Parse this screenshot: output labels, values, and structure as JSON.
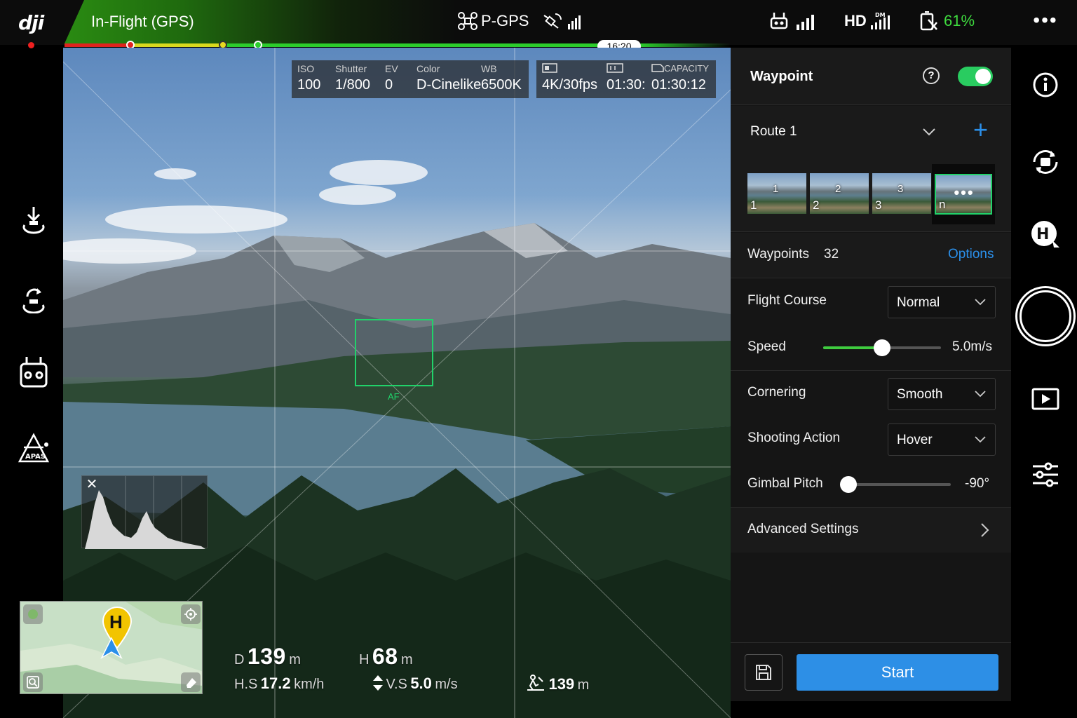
{
  "topbar": {
    "logo": "dji",
    "status": "In-Flight (GPS)",
    "gps_mode": "P-GPS",
    "hd_label": "HD",
    "hd_band": "DM",
    "battery_percent": "61%",
    "more": "•••",
    "remaining_time": "16:20"
  },
  "exposure": {
    "iso_label": "ISO",
    "iso_value": "100",
    "shutter_label": "Shutter",
    "shutter_value": "1/800",
    "ev_label": "EV",
    "ev_value": "0",
    "color_label": "Color",
    "color_value": "D-Cinelike",
    "wb_label": "WB",
    "wb_value": "6500K"
  },
  "storage": {
    "format_value": "4K/30fps",
    "rec_time_value": "01:30:",
    "capacity_label": "CAPACITY",
    "capacity_value": "01:30:12"
  },
  "camera": {
    "af_label": "AF",
    "histogram_close": "✕"
  },
  "left_controls": [
    {
      "name": "auto-takeoff-icon"
    },
    {
      "name": "return-to-home-icon"
    },
    {
      "name": "remote-controller-icon"
    },
    {
      "name": "apas-icon",
      "label": "APAS"
    }
  ],
  "map": {
    "home_marker": "H"
  },
  "telemetry": {
    "distance_label": "D",
    "distance_value": "139",
    "distance_unit": "m",
    "height_label": "H",
    "height_value": "68",
    "height_unit": "m",
    "hs_label": "H.S",
    "hs_value": "17.2",
    "hs_unit": "km/h",
    "vs_label": "V.S",
    "vs_value": "5.0",
    "vs_unit": "m/s",
    "home_dist_value": "139",
    "home_dist_unit": "m"
  },
  "panel": {
    "title": "Waypoint",
    "help": "?",
    "enabled": true,
    "route_name": "Route 1",
    "add": "+",
    "thumbnails": [
      {
        "index": "1",
        "label": "1"
      },
      {
        "index": "2",
        "label": "2"
      },
      {
        "index": "3",
        "label": "3"
      },
      {
        "index": "n",
        "label": "•••"
      }
    ],
    "waypoints_label": "Waypoints",
    "waypoints_count": "32",
    "options_label": "Options",
    "flight_course_label": "Flight Course",
    "flight_course_value": "Normal",
    "speed_label": "Speed",
    "speed_value": "5.0m/s",
    "speed_fraction": 0.5,
    "cornering_label": "Cornering",
    "cornering_value": "Smooth",
    "shooting_action_label": "Shooting Action",
    "shooting_action_value": "Hover",
    "gimbal_pitch_label": "Gimbal Pitch",
    "gimbal_pitch_value": "-90°",
    "gimbal_fraction": 0.0,
    "advanced_label": "Advanced Settings",
    "start_label": "Start"
  },
  "right_controls": [
    {
      "name": "info-icon"
    },
    {
      "name": "camera-switch-icon"
    },
    {
      "name": "home-point-icon",
      "label": "H"
    },
    {
      "name": "shutter-button"
    },
    {
      "name": "playback-icon"
    },
    {
      "name": "settings-sliders-icon"
    }
  ],
  "colors": {
    "accent_blue": "#2d8fe6",
    "accent_green": "#29cc60",
    "af_green": "#21d26a"
  }
}
